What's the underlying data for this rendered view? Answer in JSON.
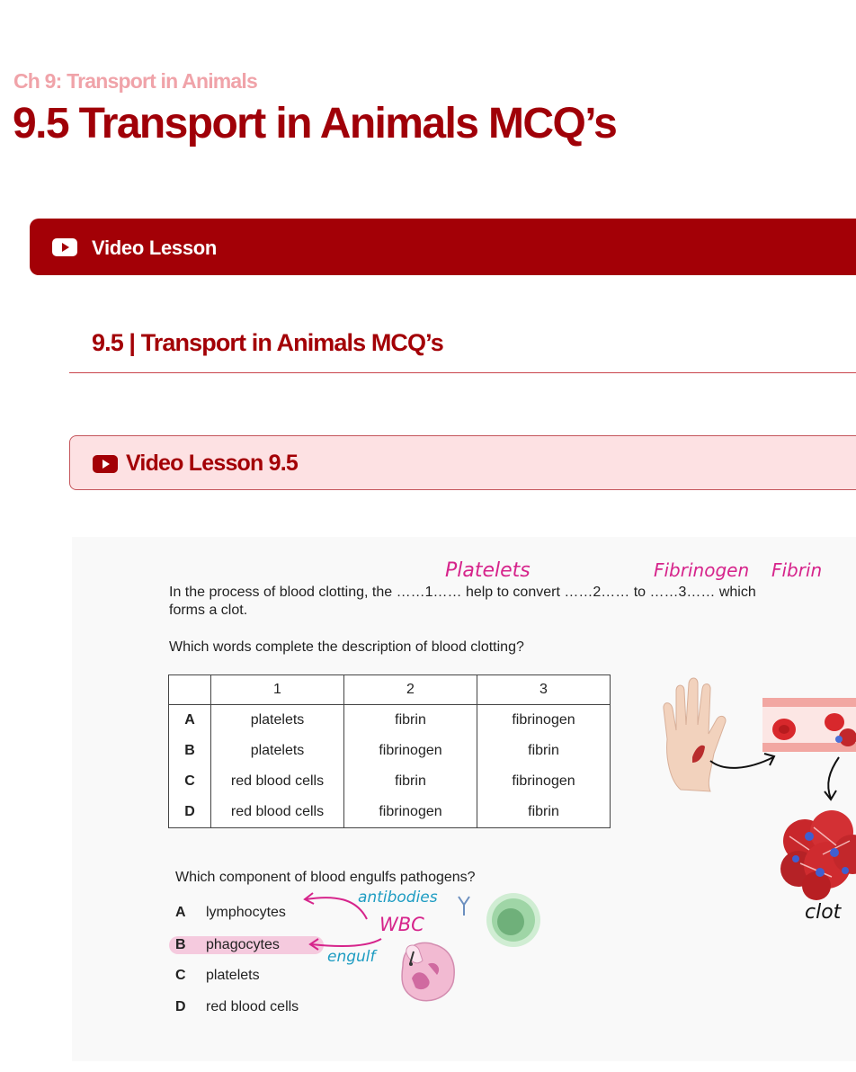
{
  "header": {
    "breadcrumb": "Ch 9: Transport in Animals",
    "title": "9.5 Transport in Animals MCQ’s"
  },
  "video_bar": {
    "label": "Video Lesson"
  },
  "section": {
    "heading": "9.5 | Transport in Animals MCQ’s"
  },
  "lesson_bar": {
    "label": "Video Lesson 9.5"
  },
  "lesson": {
    "question1": {
      "line1": "In the process of blood clotting, the ……1…… help to convert ……2…… to ……3…… which",
      "line2": "forms a clot.",
      "prompt": "Which words complete the description of blood clotting?",
      "table": {
        "headers": [
          "",
          "1",
          "2",
          "3"
        ],
        "rows": [
          [
            "A",
            "platelets",
            "fibrin",
            "fibrinogen"
          ],
          [
            "B",
            "platelets",
            "fibrinogen",
            "fibrin"
          ],
          [
            "C",
            "red blood cells",
            "fibrin",
            "fibrinogen"
          ],
          [
            "D",
            "red blood cells",
            "fibrinogen",
            "fibrin"
          ]
        ]
      },
      "annotations": {
        "a1": "Platelets",
        "a2": "Fibrinogen",
        "a3": "Fibrin",
        "clot": "clot"
      }
    },
    "question2": {
      "prompt": "Which component of blood engulfs pathogens?",
      "options": [
        {
          "letter": "A",
          "text": "lymphocytes"
        },
        {
          "letter": "B",
          "text": "phagocytes"
        },
        {
          "letter": "C",
          "text": "platelets"
        },
        {
          "letter": "D",
          "text": "red blood cells"
        }
      ],
      "annotations": {
        "antibodies": "antibodies",
        "wbc": "WBC",
        "engulf": "engulf"
      }
    }
  },
  "colors": {
    "brand": "#a30006",
    "light_brand": "#fde1e3",
    "highlight": "#f3b9d4",
    "ink_pink": "#d6248b",
    "ink_blue": "#1d9cc2"
  }
}
